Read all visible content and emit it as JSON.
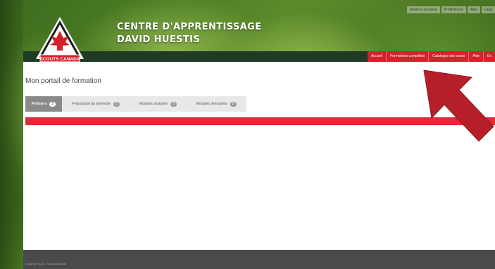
{
  "header": {
    "title_line1": "CENTRE D'APPRENTISSAGE",
    "title_line2": "DAVID HUESTIS",
    "logo_text": "SCOUTS CANADA"
  },
  "utility_links": [
    "Séances & logout",
    "Préférences",
    "Aide",
    "Lang"
  ],
  "nav": {
    "items": [
      "Accueil",
      "Formations complètes",
      "Catalogue des cours",
      "Aide",
      "Ex"
    ]
  },
  "main": {
    "page_title": "Mon portail de formation",
    "tabs": [
      {
        "label": "Premiers",
        "badge": "0"
      },
      {
        "label": "Préparation du bénévole",
        "badge": "0"
      },
      {
        "label": "Modules assignés",
        "badge": "0"
      },
      {
        "label": "Modules demandés",
        "badge": "0"
      }
    ]
  },
  "footer": {
    "copyright": "Copyright 2015 - Scouts Canada"
  },
  "colors": {
    "accent": "#e02a39",
    "nav_red": "#d6202c",
    "dark_green": "#1e3b24",
    "arrow": "#b61f2a"
  }
}
